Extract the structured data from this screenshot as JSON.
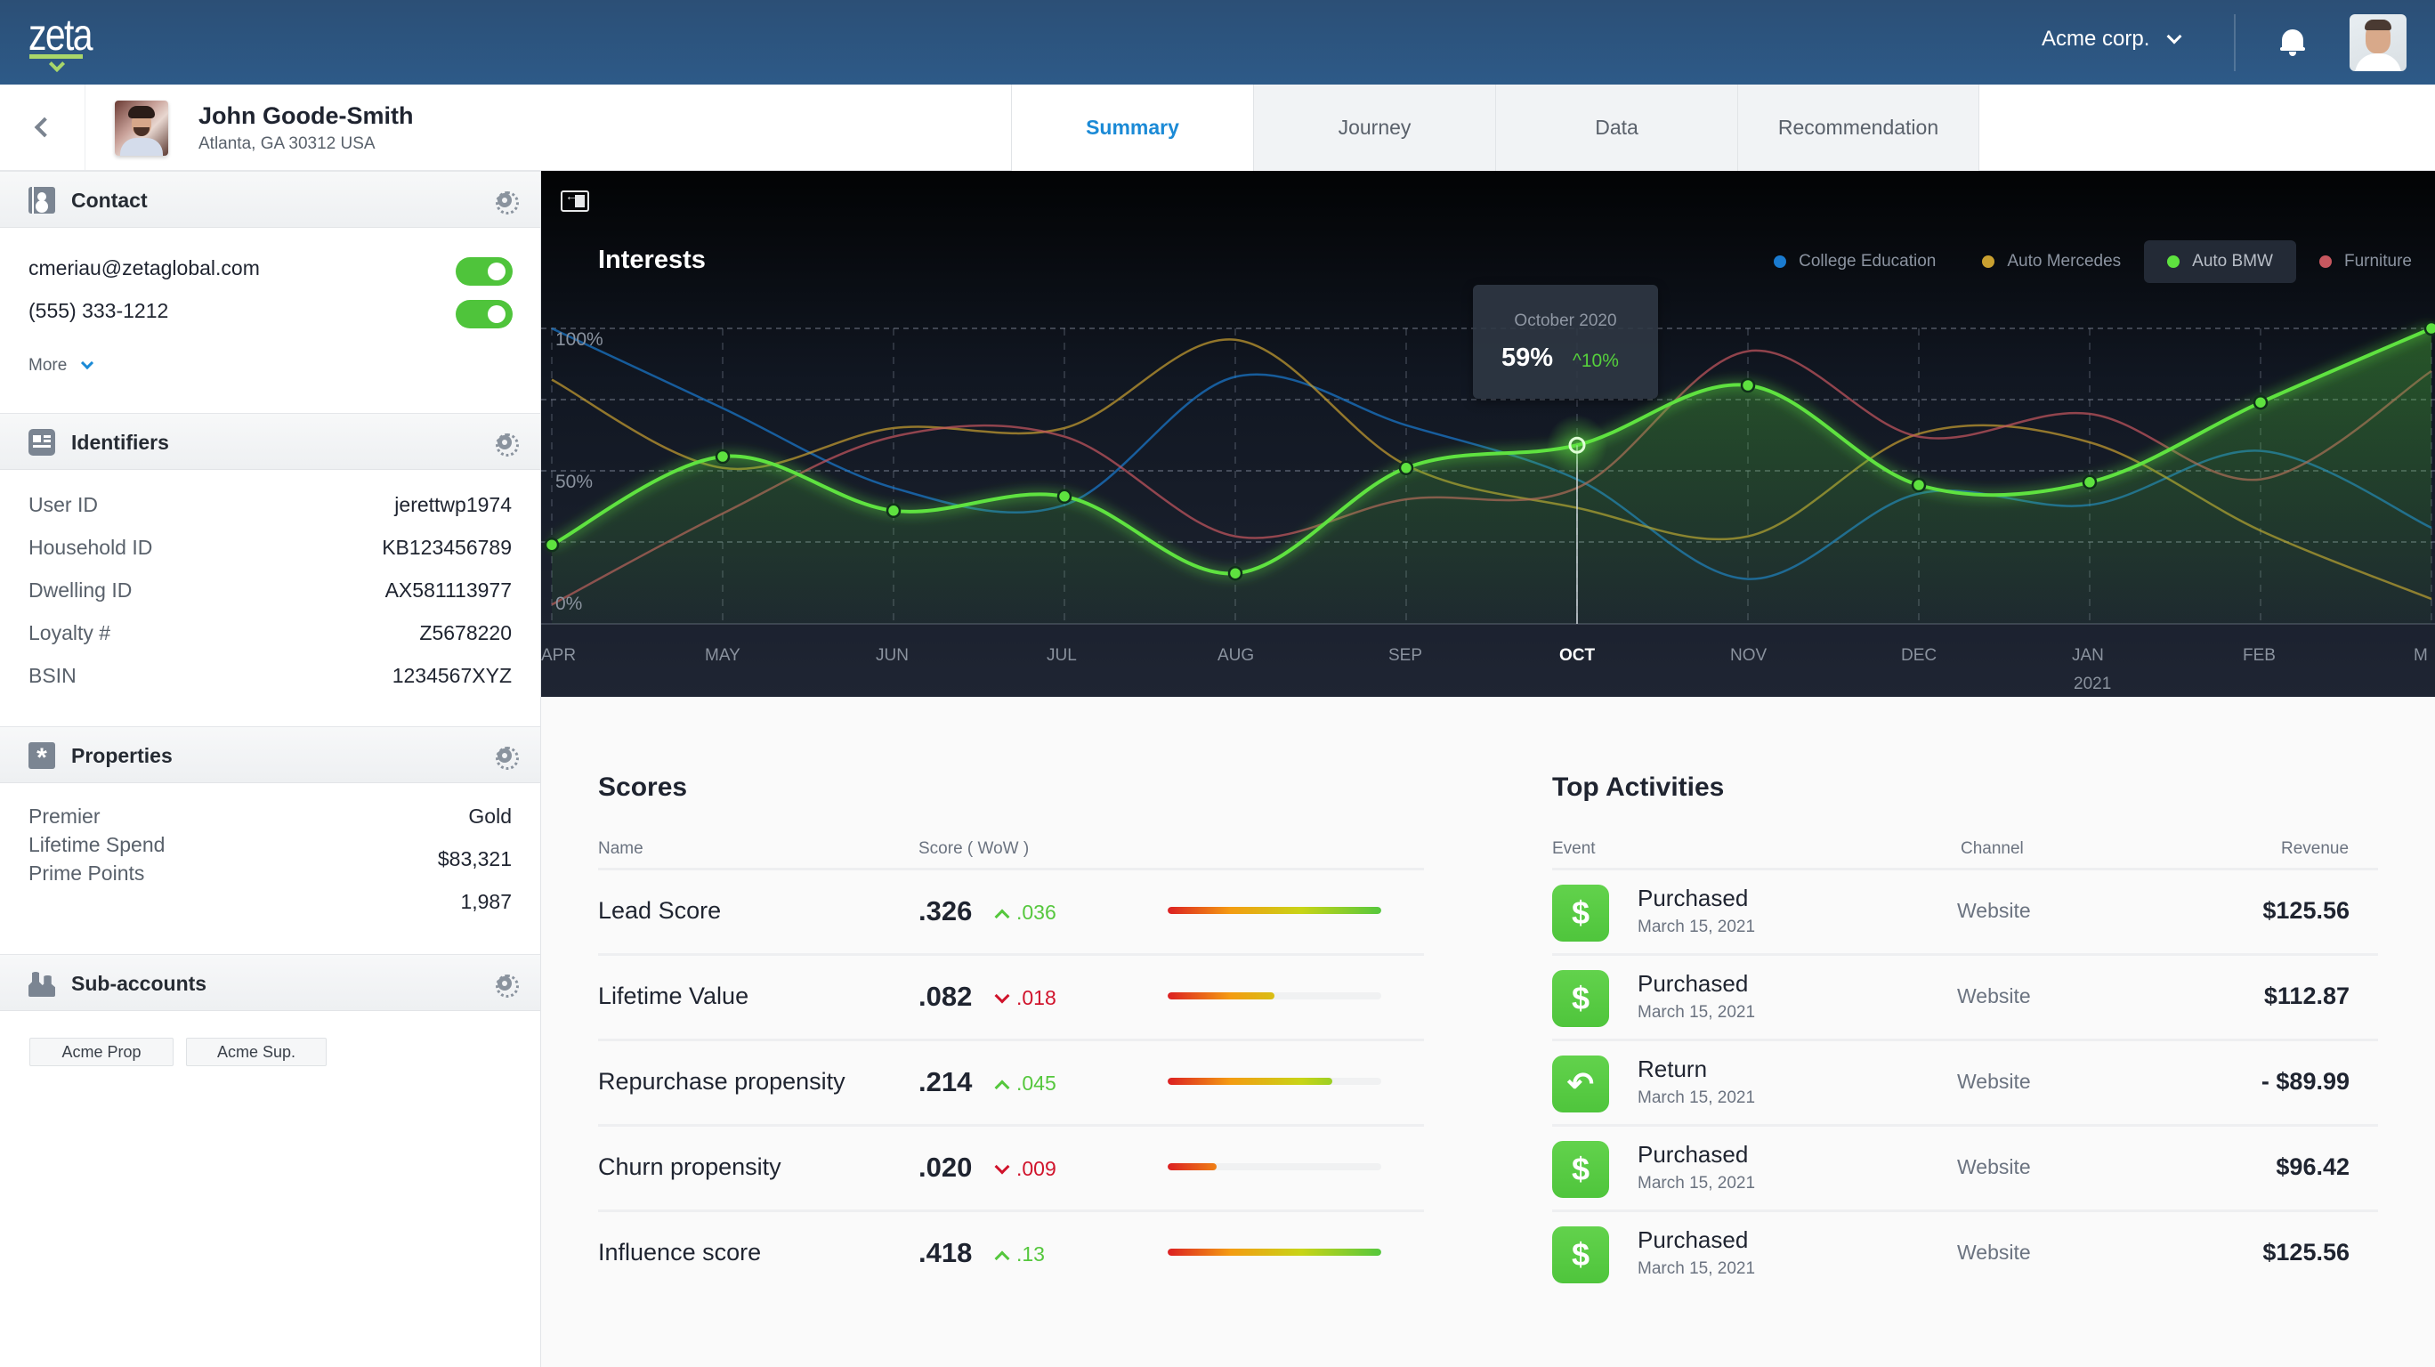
{
  "topbar": {
    "brand": "zeta",
    "org": "Acme corp.",
    "icons": {
      "notifications": "bell-icon",
      "org_menu": "chevron-down-icon"
    }
  },
  "profile": {
    "name": "John Goode-Smith",
    "location": "Atlanta, GA 30312 USA"
  },
  "tabs": [
    {
      "label": "Summary",
      "active": true
    },
    {
      "label": "Journey",
      "active": false
    },
    {
      "label": "Data",
      "active": false
    },
    {
      "label": "Recommendation",
      "active": false
    }
  ],
  "sidebar": {
    "contact": {
      "title": "Contact",
      "email": "cmeriau@zetaglobal.com",
      "email_enabled": true,
      "phone": "(555) 333-1212",
      "phone_enabled": true,
      "more_label": "More"
    },
    "identifiers": {
      "title": "Identifiers",
      "rows": [
        {
          "label": "User ID",
          "value": "jerettwp1974"
        },
        {
          "label": "Household ID",
          "value": "KB123456789"
        },
        {
          "label": "Dwelling ID",
          "value": "AX581113977"
        },
        {
          "label": "Loyalty #",
          "value": "Z5678220"
        },
        {
          "label": "BSIN",
          "value": "1234567XYZ"
        }
      ]
    },
    "properties": {
      "title": "Properties",
      "labels": [
        "Premier",
        "Lifetime Spend",
        "Prime Points"
      ],
      "values": [
        "Gold",
        "$83,321",
        "1,987"
      ]
    },
    "subaccounts": {
      "title": "Sub-accounts",
      "chips": [
        "Acme Prop",
        "Acme Sup."
      ]
    }
  },
  "chart_data": {
    "type": "line",
    "title": "Interests",
    "x": [
      "APR",
      "MAY",
      "JUN",
      "JUL",
      "AUG",
      "SEP",
      "OCT",
      "NOV",
      "DEC",
      "JAN",
      "FEB",
      "MAR"
    ],
    "x_tick_labels": [
      "APR",
      "MAY",
      "JUN",
      "JUL",
      "AUG",
      "SEP",
      "OCT",
      "NOV",
      "DEC",
      "JAN",
      "FEB",
      "M"
    ],
    "x_year_label": {
      "at": "JAN",
      "text": "2021"
    },
    "highlighted_x": "OCT",
    "y_tick_labels": [
      "100%",
      "50%",
      "0%"
    ],
    "ylim": [
      0,
      100
    ],
    "yunit": "%",
    "grid": true,
    "legend_position": "top-right",
    "series": [
      {
        "name": "College Education",
        "color": "#1a7bd0",
        "values": [
          100,
          72,
          44,
          38,
          83,
          66,
          47,
          12,
          42,
          38,
          57,
          30
        ]
      },
      {
        "name": "Auto Mercedes",
        "color": "#c9a030",
        "values": [
          82,
          51,
          65,
          65,
          96,
          52,
          37,
          27,
          63,
          60,
          29,
          5
        ]
      },
      {
        "name": "Auto BMW",
        "color": "#5ee23f",
        "active": true,
        "values": [
          24,
          55,
          36,
          41,
          14,
          51,
          59,
          80,
          45,
          46,
          74,
          100
        ]
      },
      {
        "name": "Furniture",
        "color": "#c7575f",
        "values": [
          3,
          35,
          62,
          62,
          27,
          40,
          44,
          92,
          62,
          70,
          47,
          85
        ]
      }
    ],
    "tooltip": {
      "date": "October 2020",
      "value": "59%",
      "delta": "10%",
      "delta_direction": "up"
    }
  },
  "scores": {
    "title": "Scores",
    "headers": {
      "name": "Name",
      "score": "Score ( WoW )"
    },
    "rows": [
      {
        "name": "Lead Score",
        "score": ".326",
        "delta": ".036",
        "direction": "up",
        "bar_fraction": 1.0
      },
      {
        "name": "Lifetime Value",
        "score": ".082",
        "delta": ".018",
        "direction": "down",
        "bar_fraction": 0.5
      },
      {
        "name": "Repurchase propensity",
        "score": ".214",
        "delta": ".045",
        "direction": "up",
        "bar_fraction": 0.77
      },
      {
        "name": "Churn propensity",
        "score": ".020",
        "delta": ".009",
        "direction": "down",
        "bar_fraction": 0.23
      },
      {
        "name": "Influence score",
        "score": ".418",
        "delta": ".13",
        "direction": "up",
        "bar_fraction": 1.0
      }
    ]
  },
  "activities": {
    "title": "Top Activities",
    "headers": {
      "event": "Event",
      "channel": "Channel",
      "revenue": "Revenue"
    },
    "rows": [
      {
        "icon": "dollar-icon",
        "glyph": "$",
        "event": "Purchased",
        "date": "March 15, 2021",
        "channel": "Website",
        "revenue": "$125.56"
      },
      {
        "icon": "dollar-icon",
        "glyph": "$",
        "event": "Purchased",
        "date": "March 15, 2021",
        "channel": "Website",
        "revenue": "$112.87"
      },
      {
        "icon": "return-icon",
        "glyph": "↶",
        "event": "Return",
        "date": "March 15, 2021",
        "channel": "Website",
        "revenue": "- $89.99"
      },
      {
        "icon": "dollar-icon",
        "glyph": "$",
        "event": "Purchased",
        "date": "March 15, 2021",
        "channel": "Website",
        "revenue": "$96.42"
      },
      {
        "icon": "dollar-icon",
        "glyph": "$",
        "event": "Purchased",
        "date": "March 15, 2021",
        "channel": "Website",
        "revenue": "$125.56"
      }
    ]
  }
}
